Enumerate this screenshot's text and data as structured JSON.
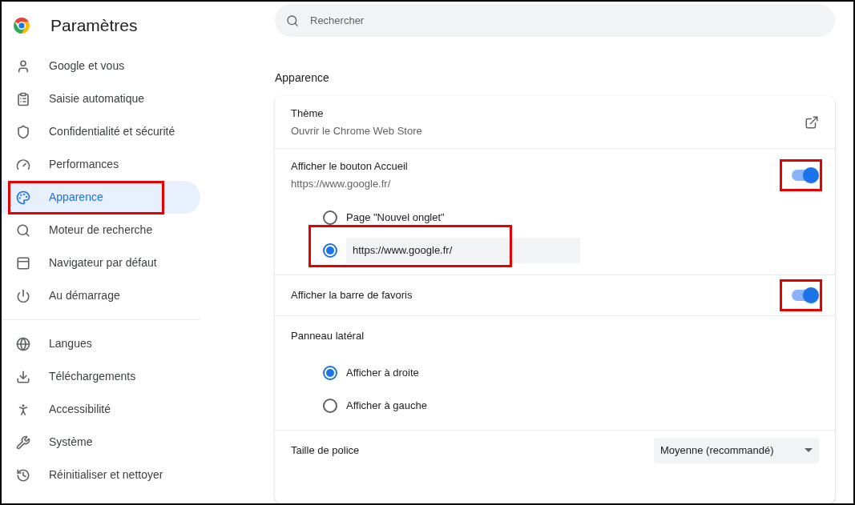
{
  "title": "Paramètres",
  "search": {
    "placeholder": "Rechercher"
  },
  "sidebar": {
    "sections": [
      {
        "items": [
          {
            "label": "Google et vous",
            "selected": false,
            "highlighted": false
          },
          {
            "label": "Saisie automatique",
            "selected": false,
            "highlighted": false
          },
          {
            "label": "Confidentialité et sécurité",
            "selected": false,
            "highlighted": false
          },
          {
            "label": "Performances",
            "selected": false,
            "highlighted": false
          },
          {
            "label": "Apparence",
            "selected": true,
            "highlighted": true
          },
          {
            "label": "Moteur de recherche",
            "selected": false,
            "highlighted": false
          },
          {
            "label": "Navigateur par défaut",
            "selected": false,
            "highlighted": false
          },
          {
            "label": "Au démarrage",
            "selected": false,
            "highlighted": false
          }
        ]
      },
      {
        "items": [
          {
            "label": "Langues",
            "selected": false,
            "highlighted": false
          },
          {
            "label": "Téléchargements",
            "selected": false,
            "highlighted": false
          },
          {
            "label": "Accessibilité",
            "selected": false,
            "highlighted": false
          },
          {
            "label": "Système",
            "selected": false,
            "highlighted": false
          },
          {
            "label": "Réinitialiser et nettoyer",
            "selected": false,
            "highlighted": false
          }
        ]
      }
    ]
  },
  "section_title": "Apparence",
  "settings": [
    {
      "kind": "link",
      "label": "Thème",
      "sublabel": "Ouvrir le Chrome Web Store"
    },
    {
      "kind": "toggle",
      "label": "Afficher le bouton Accueil",
      "sublabel": "https://www.google.fr/",
      "on": true,
      "highlighted": true,
      "options": [
        {
          "kind": "radio",
          "label": "Page \"Nouvel onglet\"",
          "selected": false,
          "highlighted": false
        },
        {
          "kind": "url",
          "value": "https://www.google.fr/",
          "selected": true,
          "highlighted": true
        }
      ]
    },
    {
      "kind": "toggle",
      "label": "Afficher la barre de favoris",
      "on": true,
      "highlighted": true
    },
    {
      "kind": "radio-group",
      "label": "Panneau latéral",
      "options": [
        {
          "kind": "radio",
          "label": "Afficher à droite",
          "selected": true,
          "highlighted": false
        },
        {
          "kind": "radio",
          "label": "Afficher à gauche",
          "selected": false,
          "highlighted": false
        }
      ]
    },
    {
      "kind": "select",
      "label": "Taille de police",
      "value": "Moyenne (recommandé)"
    }
  ]
}
